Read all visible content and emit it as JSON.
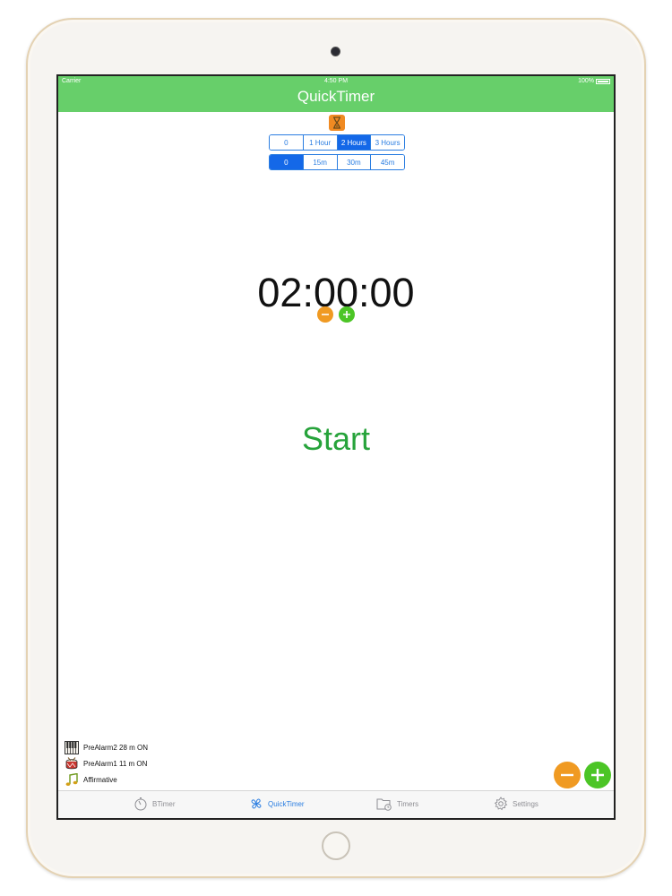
{
  "status_bar": {
    "carrier": "Carrier",
    "time": "4:50 PM",
    "battery": "100%"
  },
  "nav": {
    "title": "QuickTimer"
  },
  "hours_segment": {
    "options": [
      "0",
      "1 Hour",
      "2 Hours",
      "3 Hours"
    ],
    "selected": "2 Hours"
  },
  "minutes_segment": {
    "options": [
      "0",
      "15m",
      "30m",
      "45m"
    ],
    "selected": "0"
  },
  "timer": {
    "display": "02:00:00"
  },
  "start_label": "Start",
  "alarms": [
    {
      "icon": "piano-icon",
      "label": "PreAlarm2 28 m ON"
    },
    {
      "icon": "drum-icon",
      "label": "PreAlarm1 11 m ON"
    },
    {
      "icon": "music-note-icon",
      "label": "Affirmative"
    }
  ],
  "tabs": [
    {
      "icon": "stopwatch-icon",
      "label": "BTimer"
    },
    {
      "icon": "fan-icon",
      "label": "QuickTimer",
      "active": true
    },
    {
      "icon": "folder-clock-icon",
      "label": "Timers"
    },
    {
      "icon": "gear-icon",
      "label": "Settings"
    }
  ],
  "colors": {
    "nav_green": "#67cf6a",
    "accent_blue": "#2a7de1",
    "start_green": "#27a33b",
    "orange": "#f09a22",
    "plus_green": "#4cc526"
  }
}
